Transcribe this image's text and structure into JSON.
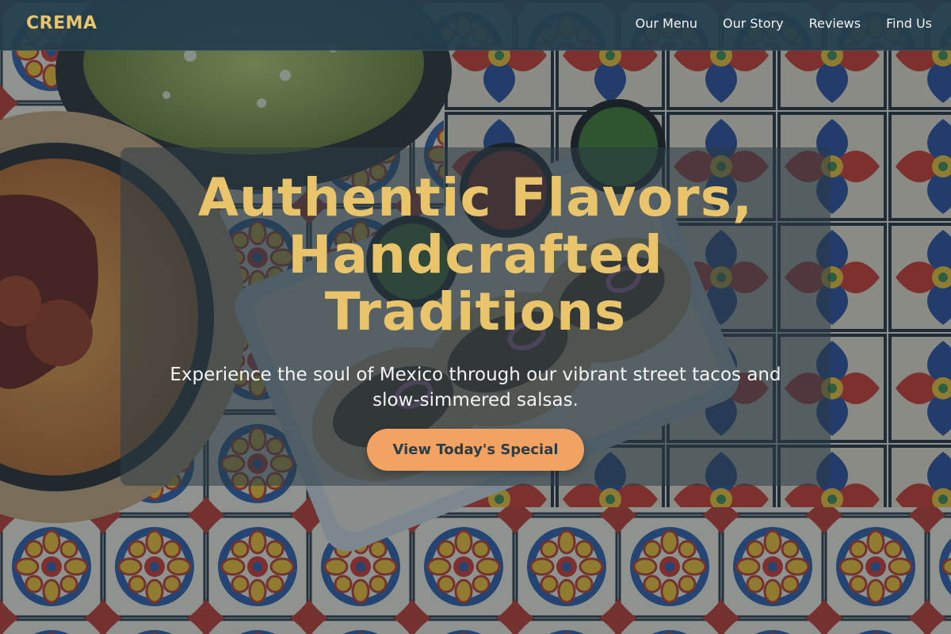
{
  "nav": {
    "brand": "CREMA",
    "links": [
      {
        "label": "Our Menu"
      },
      {
        "label": "Our Story"
      },
      {
        "label": "Reviews"
      },
      {
        "label": "Find Us"
      }
    ]
  },
  "hero": {
    "title_lines": [
      "Authentic Flavors,",
      "Handcrafted",
      "Traditions"
    ],
    "subtitle_lines": [
      "Experience the soul of Mexico through our vibrant street tacos and",
      "slow-simmered salsas."
    ],
    "cta_label": "View Today's Special",
    "background_image": "overhead-mexican-food-on-talavera-tiles"
  },
  "colors": {
    "accent": "#e9c46a",
    "cta": "#f4a261",
    "navbar": "#243e4c",
    "cta_text": "#2b3e46"
  }
}
